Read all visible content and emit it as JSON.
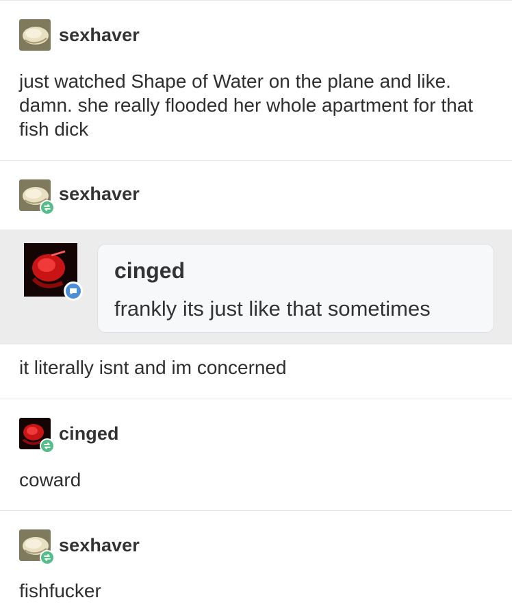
{
  "posts": [
    {
      "username": "sexhaver",
      "text": "just watched Shape of Water on the plane and like. damn. she really flooded her whole apartment for that fish dick"
    },
    {
      "username": "sexhaver",
      "reblog": true,
      "ask": {
        "asker": "cinged",
        "question": "frankly its just like that sometimes"
      },
      "text": "it literally isnt and im concerned"
    },
    {
      "username": "cinged",
      "reblog": true,
      "text": "coward"
    },
    {
      "username": "sexhaver",
      "reblog": true,
      "text": "fishfucker"
    }
  ],
  "icons": {
    "reblog": "reblog-icon",
    "chat": "chat-bubble-icon"
  },
  "colors": {
    "reblog_badge": "#56bc8a",
    "chat_badge": "#4c8fd6",
    "quote_background": "#ececec"
  }
}
